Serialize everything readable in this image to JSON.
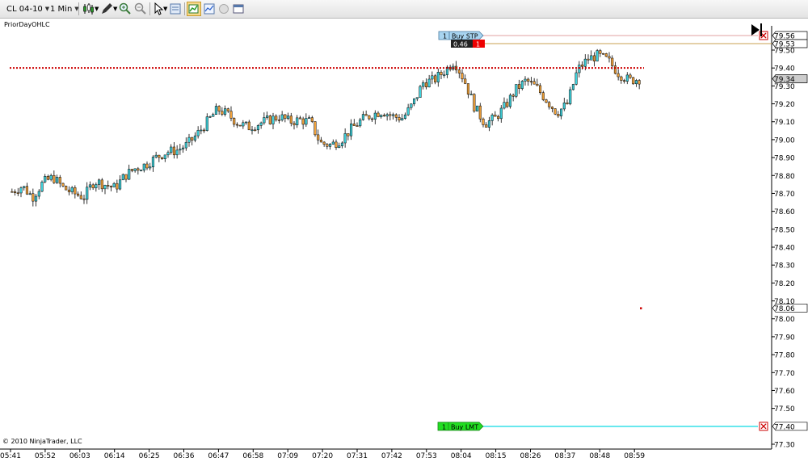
{
  "toolbar": {
    "instrument": "CL 04-10",
    "interval": "1 Min",
    "icons": [
      "candlestick-chart-icon",
      "pencil-draw-icon",
      "zoom-in-icon",
      "zoom-out-icon",
      "pointer-cursor-icon",
      "data-box-icon",
      "chart-trader-icon",
      "strategy-chart-icon",
      "circle-icon",
      "properties-icon"
    ]
  },
  "indicator_label": "PriorDayOHLC",
  "copyright": "© 2010 NinjaTrader, LLC",
  "colors": {
    "up_candle": "#3fd2dc",
    "down_candle": "#f2a23a",
    "prior_day_line": "#cc0000",
    "stop_line": "#e0a0a0",
    "position_line": "#c8a050",
    "limit_line": "#33e0e8",
    "buy_stp_tag": "#a8d4f0",
    "buy_lmt_tag": "#22dd22"
  },
  "orders": {
    "buy_stop": {
      "qty": "1",
      "label": "Buy STP",
      "price": "79.56"
    },
    "position": {
      "pnl": "0.46",
      "qty": "1",
      "price": "79.53"
    },
    "buy_limit": {
      "qty": "1",
      "label": "Buy LMT",
      "price": "77.40"
    }
  },
  "last_price": "79.34",
  "prior_day_marker_price": "78.06",
  "chart_data": {
    "type": "candlestick",
    "instrument": "CL 04-10",
    "interval": "1 Min",
    "ylim": [
      77.3,
      79.6
    ],
    "y_ticks": [
      "79.50",
      "79.40",
      "79.30",
      "79.20",
      "79.10",
      "79.00",
      "78.90",
      "78.80",
      "78.70",
      "78.60",
      "78.50",
      "78.40",
      "78.30",
      "78.20",
      "78.10",
      "78.00",
      "77.90",
      "77.80",
      "77.70",
      "77.60",
      "77.50",
      "77.30"
    ],
    "x_ticks": [
      "05:41",
      "05:52",
      "06:03",
      "06:14",
      "06:25",
      "06:36",
      "06:47",
      "06:58",
      "07:09",
      "07:20",
      "07:31",
      "07:42",
      "07:53",
      "08:04",
      "08:15",
      "08:26",
      "08:37",
      "08:48",
      "08:59"
    ],
    "prior_day_level": 79.4,
    "close_path": [
      78.71,
      78.74,
      78.68,
      78.76,
      78.79,
      78.73,
      78.7,
      78.68,
      78.77,
      78.75,
      78.73,
      78.8,
      78.84,
      78.86,
      78.9,
      78.93,
      78.94,
      78.97,
      79.03,
      79.1,
      79.17,
      79.14,
      79.09,
      79.07,
      79.09,
      79.11,
      79.13,
      79.1,
      79.11,
      79.1,
      78.98,
      78.97,
      79.0,
      79.06,
      79.11,
      79.14,
      79.16,
      79.13,
      79.12,
      79.2,
      79.32,
      79.33,
      79.38,
      79.44,
      79.33,
      79.18,
      79.09,
      79.12,
      79.19,
      79.28,
      79.33,
      79.29,
      79.22,
      79.15,
      79.2,
      79.39,
      79.45,
      79.47,
      79.44,
      79.37,
      79.33,
      79.34
    ]
  }
}
